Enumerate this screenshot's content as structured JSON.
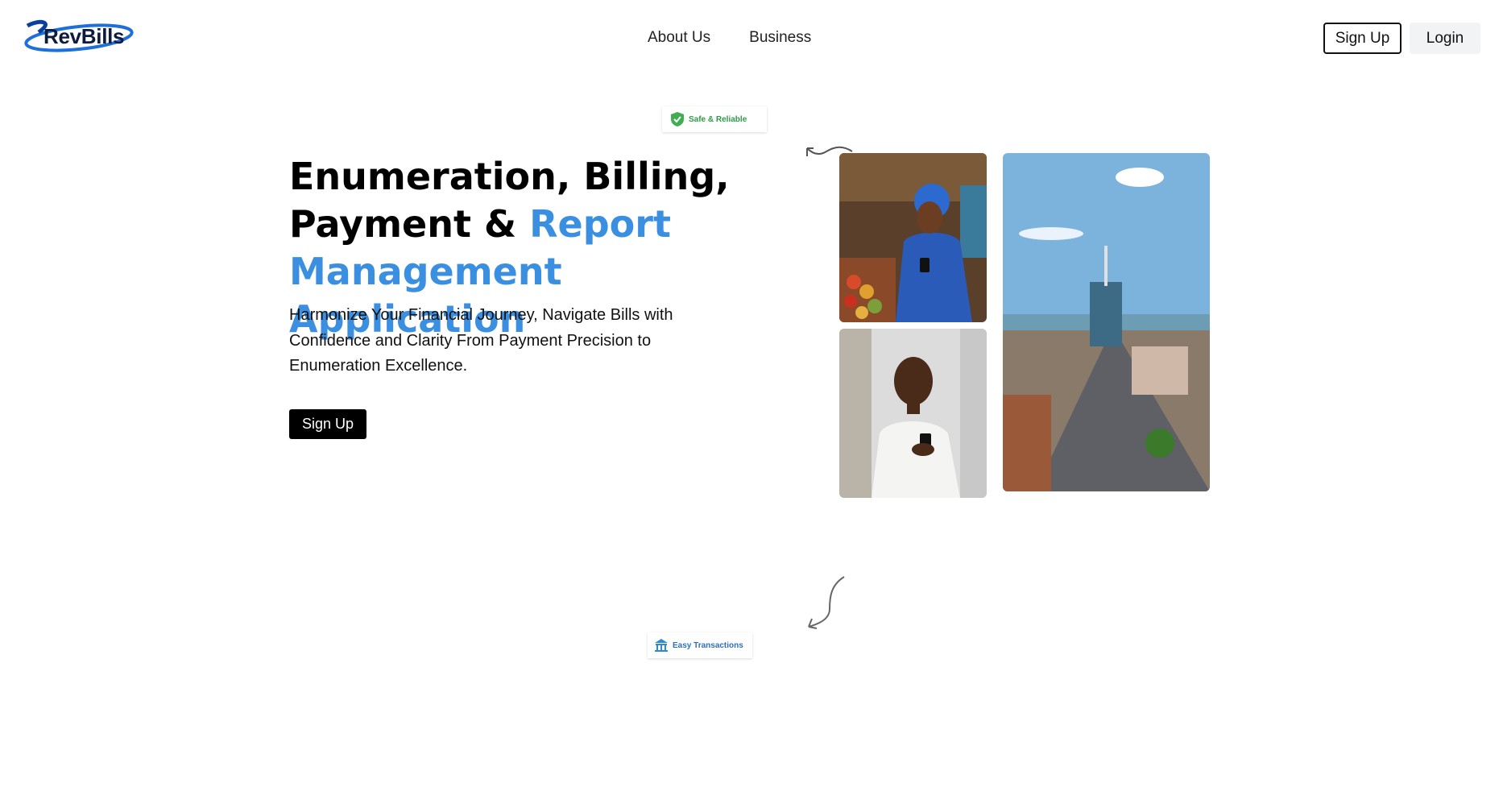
{
  "header": {
    "logo_text": "RevBills",
    "nav": [
      "About Us",
      "Business"
    ],
    "signup_label": "Sign Up",
    "login_label": "Login"
  },
  "hero": {
    "headline_line1": "Enumeration, Billing,",
    "headline_line2_dark": "Payment & ",
    "headline_line2_accent": "Report",
    "headline_line3_accent": "Management Application",
    "subtitle": "Harmonize Your Financial Journey, Navigate Bills with Confidence and Clarity From Payment Precision to Enumeration Excellence.",
    "cta_label": "Sign Up"
  },
  "badges": {
    "safe": "Safe & Reliable",
    "easy": "Easy Transactions"
  },
  "icons": {
    "safe_badge": "shield-check-icon",
    "easy_badge": "bank-icon"
  },
  "colors": {
    "accent": "#3b8fe0",
    "safe_green": "#2e9a47",
    "easy_blue": "#2d6fc2",
    "cta_bg": "#000000"
  }
}
